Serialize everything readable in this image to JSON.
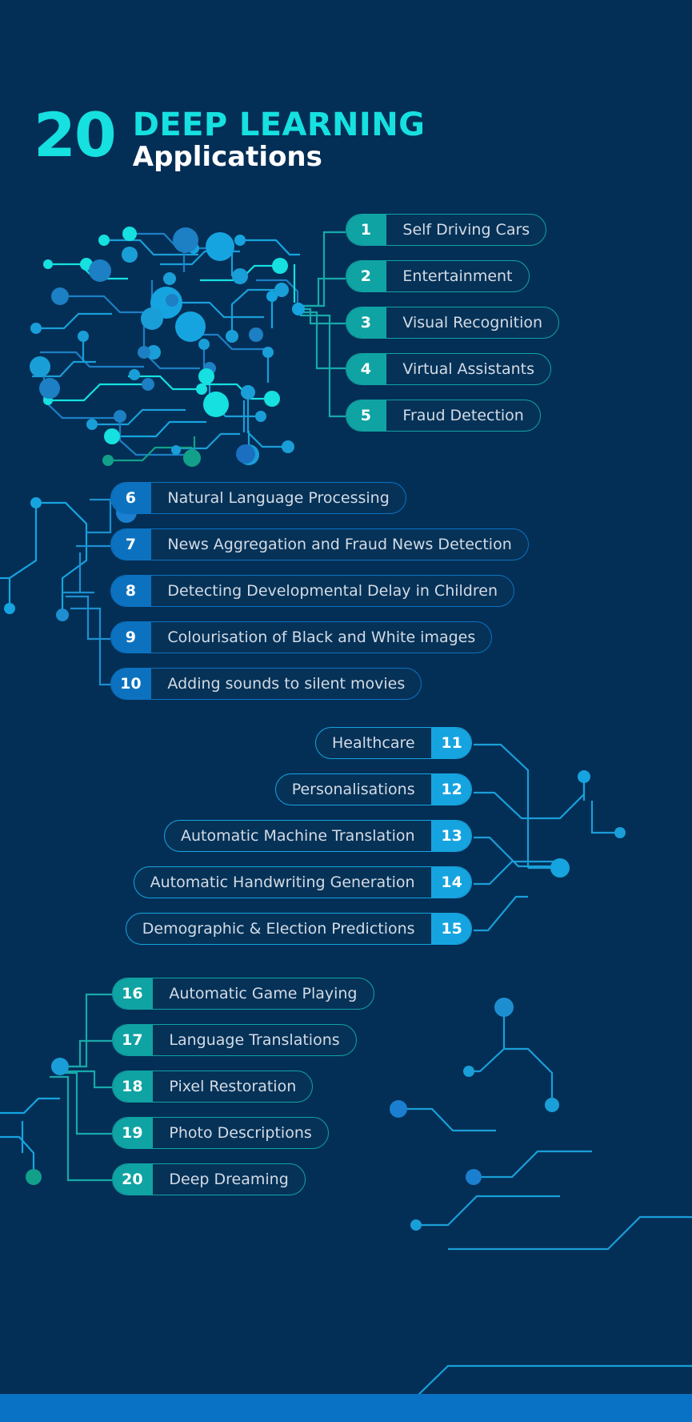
{
  "header": {
    "count": "20",
    "title_line1": "DEEP LEARNING",
    "title_line2": "Applications"
  },
  "colors": {
    "background": "#032F56",
    "accent_cyan": "#16E0E0",
    "accent_teal": "#10A3A3",
    "accent_blue": "#0C72C0",
    "accent_bright_blue": "#16A4E0",
    "label_text": "#D3DBE4",
    "bottom_bar": "#0A72C4"
  },
  "groups": [
    {
      "name": "group-one",
      "accent": "#10A3A3",
      "number_side": "left",
      "items": [
        {
          "number": "1",
          "label": "Self Driving Cars"
        },
        {
          "number": "2",
          "label": "Entertainment"
        },
        {
          "number": "3",
          "label": "Visual Recognition"
        },
        {
          "number": "4",
          "label": "Virtual Assistants"
        },
        {
          "number": "5",
          "label": "Fraud Detection"
        }
      ]
    },
    {
      "name": "group-two",
      "accent": "#0C72C0",
      "number_side": "left",
      "items": [
        {
          "number": "6",
          "label": "Natural Language Processing"
        },
        {
          "number": "7",
          "label": "News Aggregation and Fraud News Detection"
        },
        {
          "number": "8",
          "label": "Detecting Developmental Delay in Children"
        },
        {
          "number": "9",
          "label": "Colourisation of Black and White images"
        },
        {
          "number": "10",
          "label": "Adding sounds to silent movies"
        }
      ]
    },
    {
      "name": "group-three",
      "accent": "#16A4E0",
      "number_side": "right",
      "items": [
        {
          "number": "11",
          "label": "Healthcare"
        },
        {
          "number": "12",
          "label": "Personalisations"
        },
        {
          "number": "13",
          "label": "Automatic Machine Translation"
        },
        {
          "number": "14",
          "label": "Automatic Handwriting Generation"
        },
        {
          "number": "15",
          "label": "Demographic & Election Predictions"
        }
      ]
    },
    {
      "name": "group-four",
      "accent": "#10A3A3",
      "number_side": "left",
      "items": [
        {
          "number": "16",
          "label": "Automatic Game Playing"
        },
        {
          "number": "17",
          "label": "Language Translations"
        },
        {
          "number": "18",
          "label": "Pixel Restoration"
        },
        {
          "number": "19",
          "label": "Photo Descriptions"
        },
        {
          "number": "20",
          "label": "Deep Dreaming"
        }
      ]
    }
  ]
}
